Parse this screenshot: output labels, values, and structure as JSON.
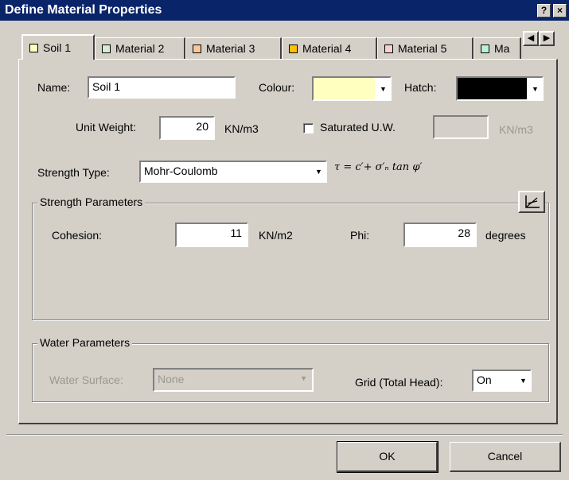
{
  "window": {
    "title": "Define Material Properties",
    "help_btn": "?",
    "close_btn": "×"
  },
  "tabs": [
    {
      "label": "Soil 1",
      "color": "#ffffc0"
    },
    {
      "label": "Material 2",
      "color": "#d8ecd0"
    },
    {
      "label": "Material 3",
      "color": "#f8c898"
    },
    {
      "label": "Material 4",
      "color": "#ffc000"
    },
    {
      "label": "Material 5",
      "color": "#f8d0d0"
    },
    {
      "label": "Ma",
      "color": "#b8f0d8"
    }
  ],
  "tab_scroll": {
    "left": "◀",
    "right": "▶"
  },
  "name": {
    "label": "Name:",
    "value": "Soil 1"
  },
  "colour": {
    "label": "Colour:",
    "value_color": "#ffffc0"
  },
  "hatch": {
    "label": "Hatch:",
    "value_color": "#000000"
  },
  "unit_weight": {
    "label": "Unit Weight:",
    "value": "20",
    "unit": "KN/m3"
  },
  "saturated_uw": {
    "label": "Saturated U.W.",
    "value": "",
    "unit": "KN/m3",
    "checked": false
  },
  "strength_type": {
    "label": "Strength Type:",
    "value": "Mohr-Coulomb",
    "formula": "τ = c′+ σ′ₙ tan φ′"
  },
  "strength_params": {
    "legend": "Strength Parameters",
    "cohesion": {
      "label": "Cohesion:",
      "value": "11",
      "unit": "KN/m2"
    },
    "phi": {
      "label": "Phi:",
      "value": "28",
      "unit": "degrees"
    }
  },
  "water_params": {
    "legend": "Water Parameters",
    "water_surface": {
      "label": "Water Surface:",
      "value": "None"
    },
    "grid": {
      "label": "Grid (Total Head):",
      "value": "On"
    }
  },
  "buttons": {
    "ok": "OK",
    "cancel": "Cancel"
  },
  "icons": {
    "dropdown": "▼",
    "graph": "graph-icon"
  }
}
